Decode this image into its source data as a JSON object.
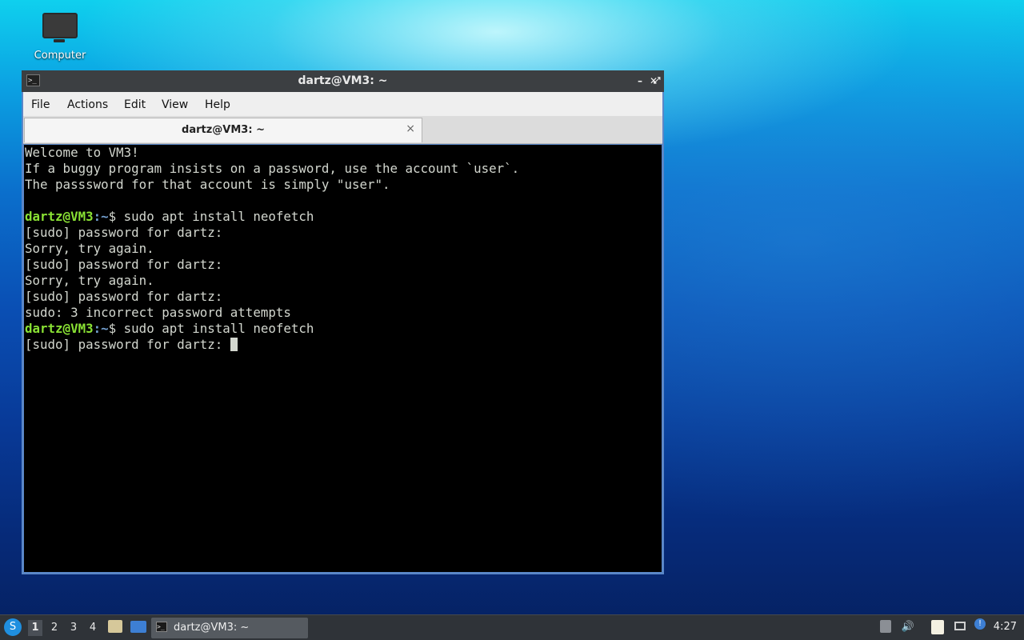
{
  "desktop": {
    "icons": [
      {
        "label": "Computer",
        "icon": "computer-icon"
      }
    ]
  },
  "window": {
    "title": "dartz@VM3: ~",
    "controls": {
      "minimize": "–",
      "maximize": "⤢",
      "close": "✕"
    },
    "menu": [
      "File",
      "Actions",
      "Edit",
      "View",
      "Help"
    ],
    "tab": {
      "label": "dartz@VM3: ~",
      "close": "×"
    }
  },
  "terminal": {
    "lines": [
      {
        "text": "Welcome to VM3!"
      },
      {
        "text": "If a buggy program insists on a password, use the account `user`."
      },
      {
        "text": "The passsword for that account is simply \"user\"."
      },
      {
        "text": ""
      },
      {
        "user": "dartz@VM3",
        "path": ":~",
        "cmd": "$ sudo apt install neofetch"
      },
      {
        "text": "[sudo] password for dartz:"
      },
      {
        "text": "Sorry, try again."
      },
      {
        "text": "[sudo] password for dartz:"
      },
      {
        "text": "Sorry, try again."
      },
      {
        "text": "[sudo] password for dartz:"
      },
      {
        "text": "sudo: 3 incorrect password attempts"
      },
      {
        "user": "dartz@VM3",
        "path": ":~",
        "cmd": "$ sudo apt install neofetch"
      },
      {
        "text": "[sudo] password for dartz: ",
        "cursor": true
      }
    ],
    "colors": {
      "background": "#000000",
      "text": "#d3d7cf",
      "user": "#8ae234",
      "path": "#729fcf"
    }
  },
  "taskbar": {
    "workspaces": [
      "1",
      "2",
      "3",
      "4"
    ],
    "active_workspace": "1",
    "task": {
      "label": "dartz@VM3: ~"
    },
    "clock": "4:27"
  }
}
